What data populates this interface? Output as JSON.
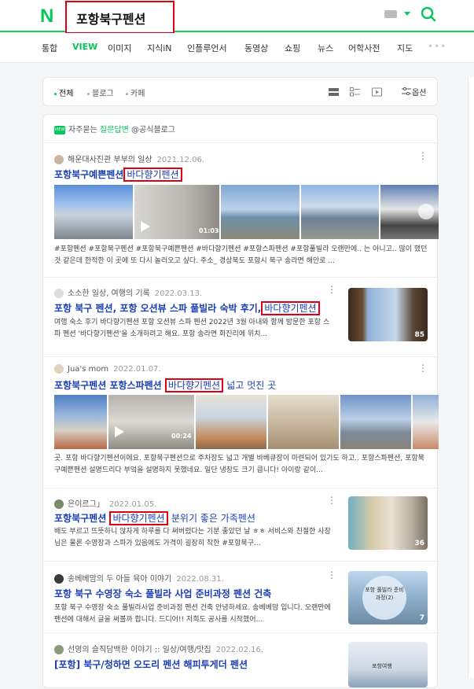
{
  "header": {
    "logo": "N",
    "query": "포항북구펜션"
  },
  "tabs": [
    "통합",
    "VIEW",
    "이미지",
    "지식iN",
    "인플루언서",
    "동영상",
    "쇼핑",
    "뉴스",
    "어학사전",
    "지도",
    "•••"
  ],
  "filters": {
    "items": [
      "전체",
      "블로그",
      "카페"
    ],
    "options_label": "옵션"
  },
  "qa": {
    "badge": "VIEW",
    "prefix": "자주묻는",
    "highlight": "질문답변",
    "suffix": "@공식블로그"
  },
  "posts": [
    {
      "author": "해운대사진관 부부의 일상",
      "date": "2021.12.06.",
      "title_pre": "포항북구예쁜펜션",
      "title_hl": "바다향기펜션",
      "title_post": "",
      "desc": "#포항펜션 #포항북구펜션 #포항북구예쁜펜션 #바다향기펜션 #포항스파펜션 #포항풀빌라 오랜만에.. 는 아니고.. 많이 했던 것 같은데 한적한 이 곳에 또 다시 놀러오고 싶다. 주소_ 경상북도 포항시 북구 송라면 해안로 ...",
      "video_duration": "01:03"
    },
    {
      "author": "소소한 일상, 여행의 기록",
      "date": "2022.03.13.",
      "title_pre": "포항 북구 펜션, 포항 오션뷰 스파 풀빌라 숙박 후기,",
      "title_hl": "바다향기펜션",
      "title_post": "",
      "desc": "여행 숙소 후기 바다향기펜션 포항 오션뷰 스파 펜션 2022년 3월 아내와 함께 방문한 포항 스파 펜션 '바다향기펜션'을 소개하려고 해요. 포항 송라면 화진리에 위치...",
      "count": "85"
    },
    {
      "author": "Jua's mom",
      "date": "2022.01.07.",
      "title_pre": "포항북구펜션 포항스파펜션",
      "title_hl": "바다향기펜션",
      "title_post": "넓고 멋진 곳",
      "desc": "곳. 포항 바다향기펜션이에요. 포항북구펜션으로 주차장도 넓고 개별 바베큐장이 마련되어 있기도 하고.. 포항스파펜션, 포항북구예쁜펜션 설명드리다 부엌을 설명하지 못했네요. 일단 냉장도 크기 큽니다! 아이랑 같이...",
      "video_duration": "00:24"
    },
    {
      "author": "은이르그」",
      "date": "2022.01.05.",
      "title_pre": "포항북구펜션",
      "title_hl": "바다향기펜션",
      "title_post": "분위기 좋은 가족펜션",
      "desc": "배도 부르고 뜨뜻하니 앉자게 하루를 다 써버렸다는 기분 좋았던 날 ㅎㅎ 서비스와 친절한 사장님은 물론 수영장과 스파가 있음에도 가격이 굉장히 착한 #포항북구...",
      "count": "36"
    },
    {
      "author": "송베베맘의 두 아들 육아 이야기",
      "date": "2022.08.31.",
      "title_pre": "포항 북구 수영장 숙소 풀빌라 사업 준비과정 펜션 건축",
      "desc": "포항 북구 수영장 숙소 풀빌라사업 준비과정 펜션 건축 안녕하세요. 송베베맘 입니다. 오랜만에 펜션에 대해서 글을 써볼까 합니다. 드디어!! 저희도 공사를 시작했어...",
      "count": "7",
      "thumb_label": "포항 풀빌라 준비 과정(2)"
    },
    {
      "author": "선영의 슬직담백한 이야기 :: 일상/여행/맛집",
      "date": "2022.02.16.",
      "title_pre": "[포항] 북구/청하면 오도리 펜션 해피투게더 펜션",
      "thumb_label": "포항여행"
    }
  ],
  "colors": {
    "brand_green": "#03c75a",
    "link_blue": "#1a3fb5",
    "highlight_red": "#e0000f"
  }
}
